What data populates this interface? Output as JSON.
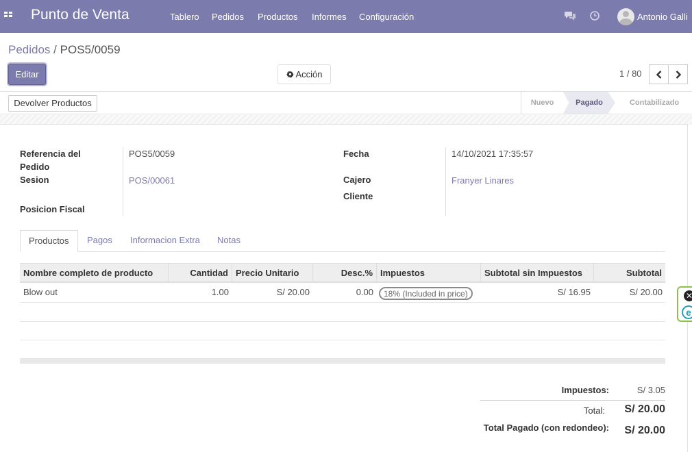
{
  "navbar": {
    "brand": "Punto de Venta",
    "menu": [
      "Tablero",
      "Pedidos",
      "Productos",
      "Informes",
      "Configuración"
    ],
    "user": "Antonio Galli",
    "icons": [
      "apps-icon",
      "chat-icon",
      "clock-icon",
      "avatar"
    ],
    "color": "#7c7bad"
  },
  "breadcrumb": {
    "parent": "Pedidos",
    "separator": "/",
    "current": "POS5/0059"
  },
  "toolbar": {
    "edit_label": "Editar",
    "action_label": "Acción",
    "pager": "1 / 80"
  },
  "statusbar": {
    "return_label": "Devolver Productos",
    "stages": [
      "Nuevo",
      "Pagado",
      "Contabilizado"
    ],
    "active_stage": "Pagado"
  },
  "form": {
    "ref_label_1": "Referencia del",
    "ref_label_2": "Pedido",
    "ref_value": "POS5/0059",
    "session_label": "Sesion",
    "session_value": "POS/00061",
    "fiscal_label": "Posicion Fiscal",
    "date_label": "Fecha",
    "date_value": "14/10/2021 17:35:57",
    "cashier_label": "Cajero",
    "cashier_value": "Franyer Linares",
    "customer_label": "Cliente"
  },
  "tabs": [
    "Productos",
    "Pagos",
    "Informacion Extra",
    "Notas"
  ],
  "table": {
    "headers": [
      "Nombre completo de producto",
      "Cantidad",
      "Precio Unitario",
      "Desc.%",
      "Impuestos",
      "Subtotal sin Impuestos",
      "Subtotal"
    ],
    "rows": [
      {
        "product": "Blow out",
        "qty": "1.00",
        "price": "S/ 20.00",
        "discount": "0.00",
        "tax": "18% (Included in price)",
        "subtotal_untaxed": "S/ 16.95",
        "subtotal": "S/ 20.00"
      }
    ]
  },
  "totals": {
    "tax_label": "Impuestos:",
    "tax_value": "S/ 3.05",
    "total_label": "Total:",
    "total_value": "S/ 20.00",
    "paid_label": "Total Pagado (con redondeo):",
    "paid_value": "S/ 20.00"
  },
  "extension": {
    "close_glyph": "✕",
    "e_glyph": "e"
  }
}
